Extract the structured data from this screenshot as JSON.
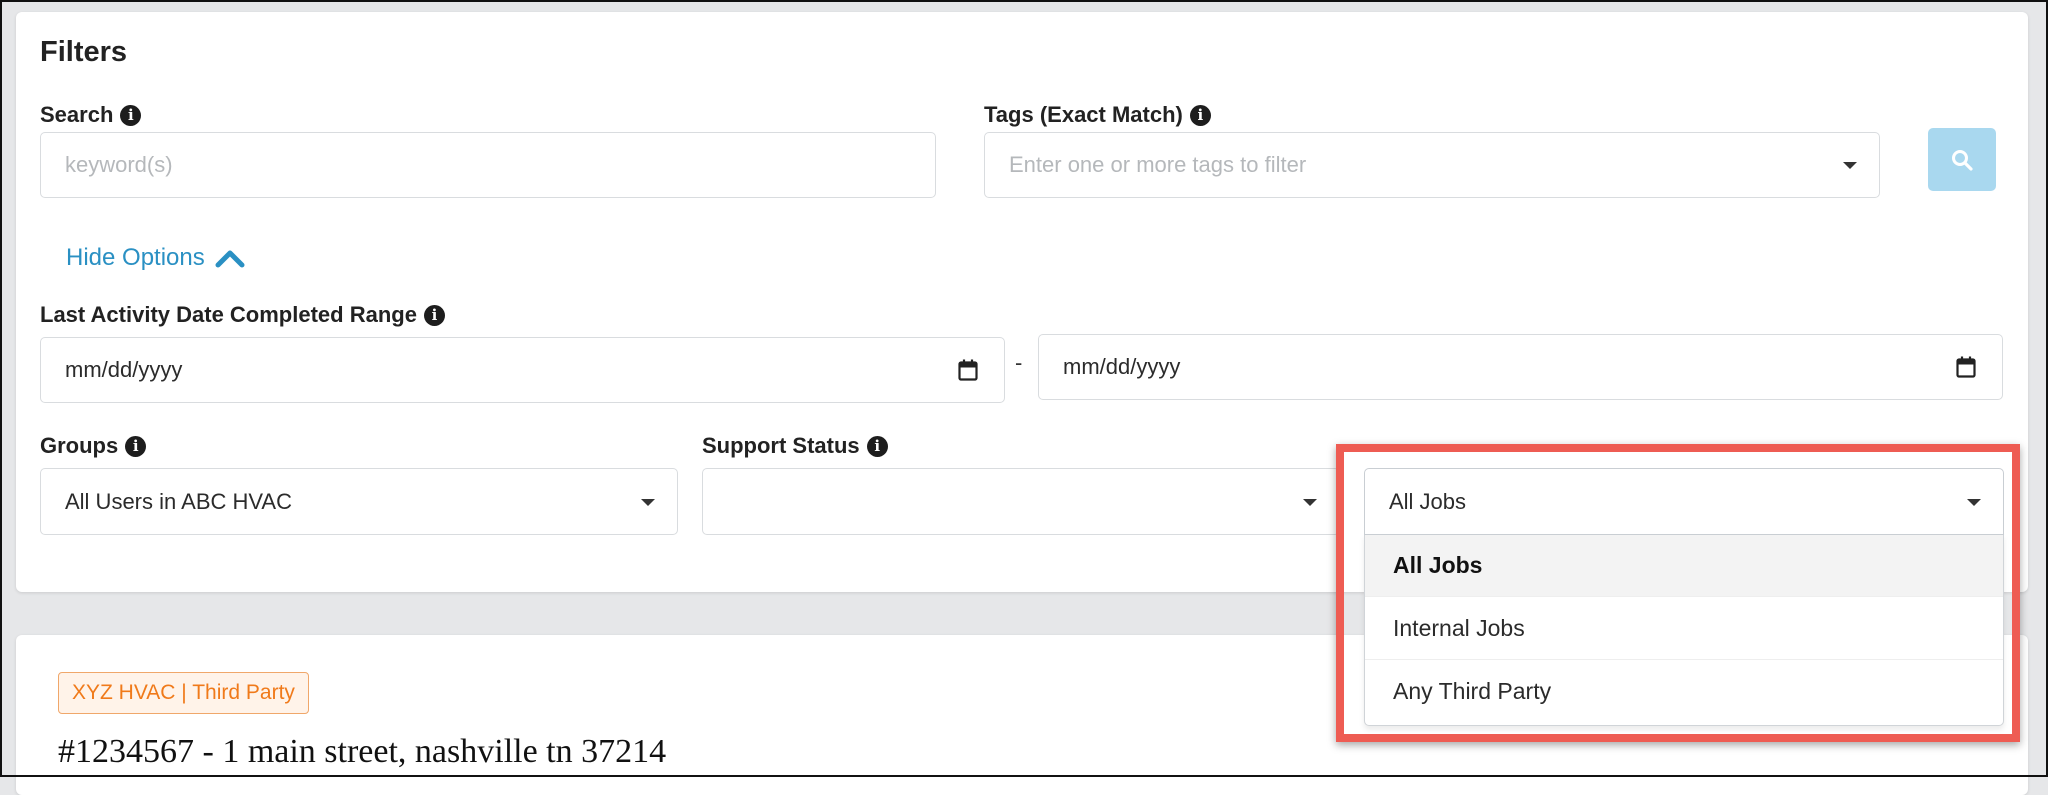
{
  "filters": {
    "title": "Filters",
    "search": {
      "label": "Search",
      "placeholder": "keyword(s)",
      "value": ""
    },
    "tags": {
      "label": "Tags (Exact Match)",
      "placeholder": "Enter one or more tags to filter"
    },
    "search_button_icon": "search-icon",
    "hide_options_label": "Hide Options",
    "date_range": {
      "label": "Last Activity Date Completed Range",
      "start_value": "mm/dd/yyyy",
      "separator": "-",
      "end_value": "mm/dd/yyyy"
    },
    "groups": {
      "label": "Groups",
      "value": "All Users in ABC HVAC"
    },
    "support_status": {
      "label": "Support Status",
      "value": ""
    },
    "jobs": {
      "value": "All Jobs",
      "options": [
        {
          "label": "All Jobs",
          "selected": true
        },
        {
          "label": "Internal Jobs",
          "selected": false
        },
        {
          "label": "Any Third Party",
          "selected": false
        }
      ]
    }
  },
  "job_card": {
    "badge": "XYZ HVAC | Third Party",
    "title": "#1234567 - 1 main street, nashville tn 37214"
  },
  "colors": {
    "accent_link": "#2a90c3",
    "search_button": "#a9d8ef",
    "highlight_border": "#ee5c53",
    "badge_text": "#f07a1a",
    "badge_border": "#f0a76a",
    "badge_bg": "#fff3e9"
  }
}
